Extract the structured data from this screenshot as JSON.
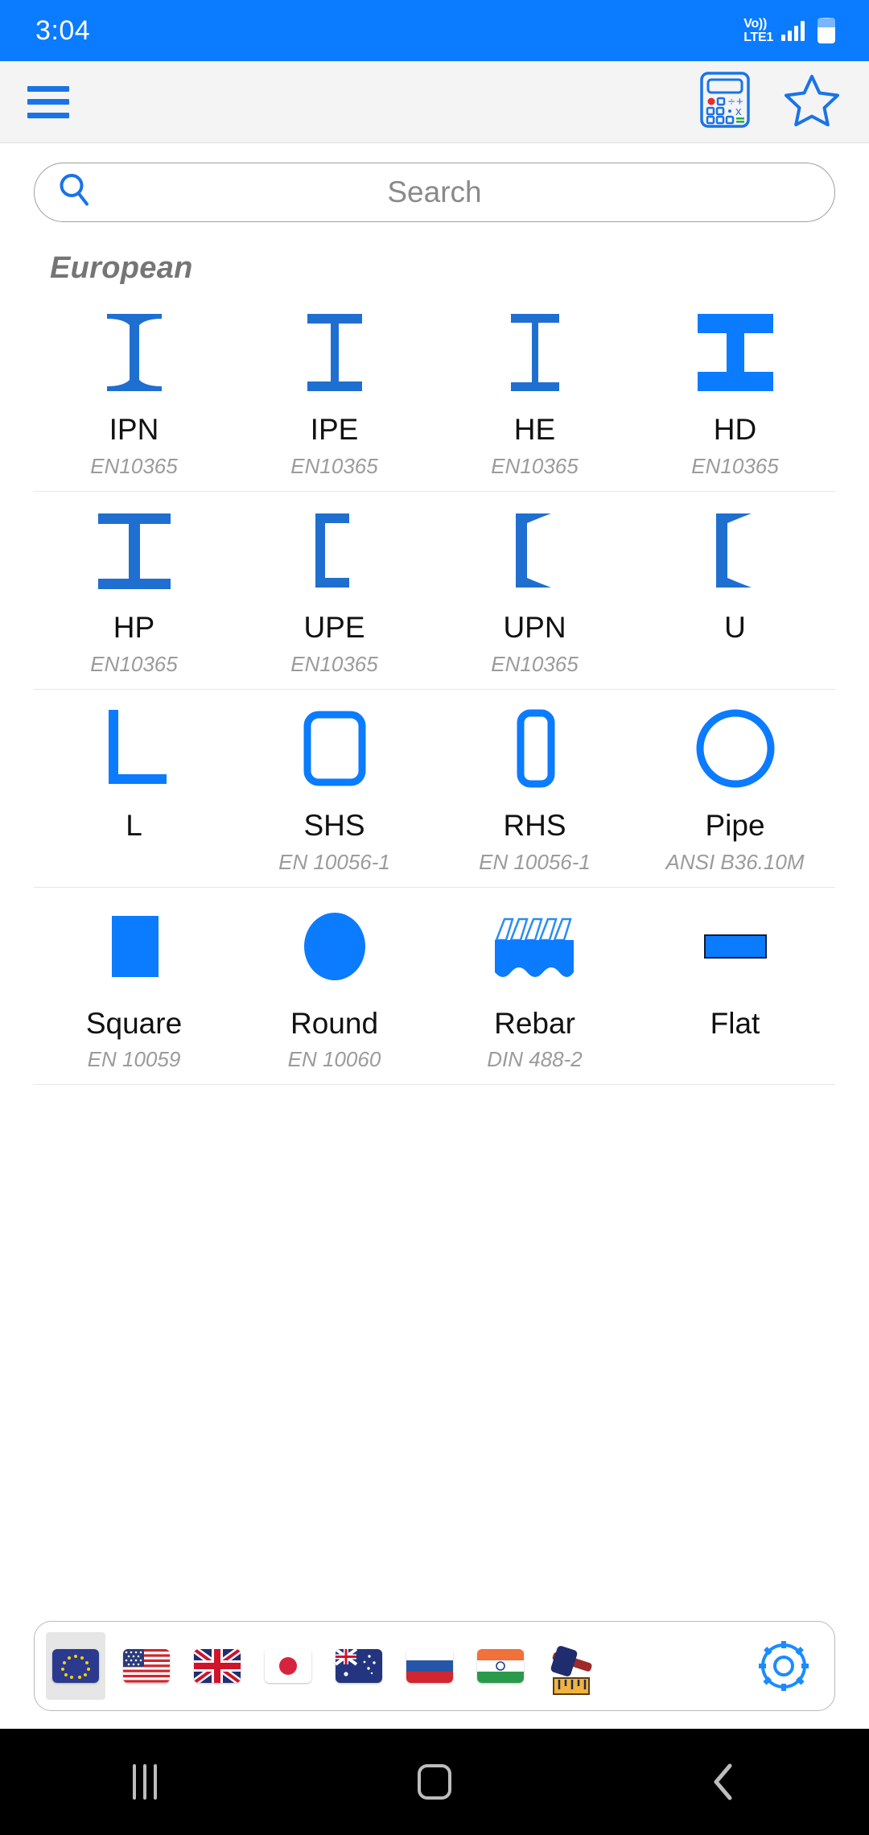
{
  "statusbar": {
    "time": "3:04",
    "network_line1": "Vo))",
    "network_line2": "LTE1",
    "signal_icon": "signal-bars-icon",
    "battery_icon": "battery-icon"
  },
  "appbar": {
    "menu_icon": "hamburger-menu-icon",
    "calculator_icon": "calculator-icon",
    "favorite_icon": "star-outline-icon"
  },
  "search": {
    "placeholder": "Search",
    "value": "",
    "icon": "search-icon"
  },
  "section": {
    "title": "European"
  },
  "colors": {
    "accent": "#0b7bff",
    "profile_blue": "#1f6fd0",
    "shape_blue": "#0b7bff",
    "appbar_bg": "#f4f4f4",
    "label": "#111111",
    "standard": "#9b9b9b",
    "section_title": "#757575"
  },
  "profiles": [
    [
      {
        "name": "IPN",
        "standard": "EN10365",
        "icon": "i-beam-tapered-icon"
      },
      {
        "name": "IPE",
        "standard": "EN10365",
        "icon": "i-beam-icon"
      },
      {
        "name": "HE",
        "standard": "EN10365",
        "icon": "h-beam-icon"
      },
      {
        "name": "HD",
        "standard": "EN10365",
        "icon": "h-beam-wide-icon"
      }
    ],
    [
      {
        "name": "HP",
        "standard": "EN10365",
        "icon": "hp-beam-icon"
      },
      {
        "name": "UPE",
        "standard": "EN10365",
        "icon": "channel-icon"
      },
      {
        "name": "UPN",
        "standard": "EN10365",
        "icon": "channel-tapered-icon"
      },
      {
        "name": "U",
        "standard": "",
        "icon": "channel-u-icon"
      }
    ],
    [
      {
        "name": "L",
        "standard": "",
        "icon": "angle-icon"
      },
      {
        "name": "SHS",
        "standard": "EN 10056-1",
        "icon": "square-hollow-section-icon"
      },
      {
        "name": "RHS",
        "standard": "EN 10056-1",
        "icon": "rectangular-hollow-section-icon"
      },
      {
        "name": "Pipe",
        "standard": "ANSI B36.10M",
        "icon": "pipe-circle-icon"
      }
    ],
    [
      {
        "name": "Square",
        "standard": "EN 10059",
        "icon": "solid-square-bar-icon"
      },
      {
        "name": "Round",
        "standard": "EN 10060",
        "icon": "solid-round-bar-icon"
      },
      {
        "name": "Rebar",
        "standard": "DIN 488-2",
        "icon": "rebar-icon"
      },
      {
        "name": "Flat",
        "standard": "",
        "icon": "flat-bar-icon"
      }
    ]
  ],
  "regionbar": {
    "items": [
      {
        "id": "eu",
        "label": "European",
        "icon": "flag-eu-icon",
        "selected": true
      },
      {
        "id": "us",
        "label": "American",
        "icon": "flag-us-icon",
        "selected": false
      },
      {
        "id": "uk",
        "label": "British",
        "icon": "flag-uk-icon",
        "selected": false
      },
      {
        "id": "jp",
        "label": "Japanese",
        "icon": "flag-japan-icon",
        "selected": false
      },
      {
        "id": "au",
        "label": "Australian",
        "icon": "flag-australia-icon",
        "selected": false
      },
      {
        "id": "ru",
        "label": "Russian",
        "icon": "flag-russia-icon",
        "selected": false
      },
      {
        "id": "in",
        "label": "Indian",
        "icon": "flag-india-icon",
        "selected": false
      },
      {
        "id": "tools",
        "label": "Tools",
        "icon": "hammer-ruler-icon",
        "selected": false
      }
    ],
    "settings_icon": "gear-icon"
  },
  "navbar": {
    "recents_icon": "recents-icon",
    "home_icon": "home-icon",
    "back_icon": "back-chevron-icon"
  }
}
